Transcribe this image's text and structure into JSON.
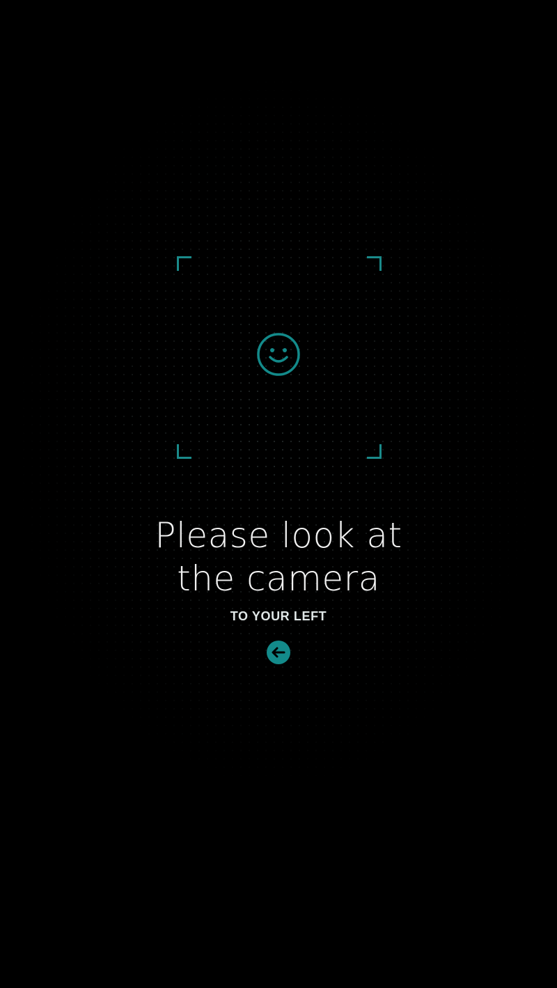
{
  "screen": {
    "background_color": "#000000",
    "accent_color": "#138a8a"
  },
  "instruction": {
    "line1": "Please look at",
    "line2": "the camera",
    "direction": "TO YOUR LEFT"
  },
  "icons": {
    "face": "smiley-face-icon",
    "direction": "arrow-left-icon"
  }
}
